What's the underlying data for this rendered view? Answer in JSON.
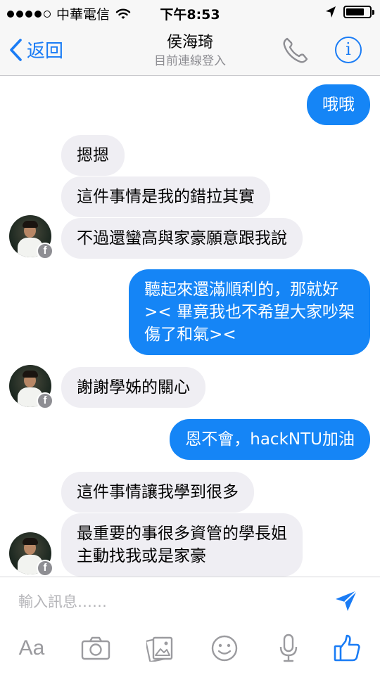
{
  "status_bar": {
    "carrier": "中華電信",
    "time": "下午8:53"
  },
  "nav": {
    "back_label": "返回",
    "contact_name": "侯海琦",
    "contact_status": "目前連線登入"
  },
  "messages": [
    {
      "side": "out",
      "text": "哦哦"
    },
    {
      "side": "in",
      "text": "摁摁"
    },
    {
      "side": "in",
      "text": "這件事情是我的錯拉其實"
    },
    {
      "side": "in",
      "text": "不過還蠻高與家豪願意跟我說"
    },
    {
      "side": "out",
      "text": "聽起來還滿順利的，那就好\n>< 畢竟我也不希望大家吵架\n傷了和氣><"
    },
    {
      "side": "in",
      "text": "謝謝學姊的關心"
    },
    {
      "side": "out",
      "text": "恩不會，hackNTU加油"
    },
    {
      "side": "in",
      "text": "這件事情讓我學到很多"
    },
    {
      "side": "in",
      "text": "最重要的事很多資管的學長姐\n主動找我或是家豪"
    }
  ],
  "avatar_badge": "f",
  "composer": {
    "placeholder": "輸入訊息……",
    "text_tool_label": "Aa"
  },
  "colors": {
    "accent": "#1a7cf5",
    "outgoing_bubble": "#1585f6",
    "incoming_bubble": "#efeef3",
    "icon_gray": "#9b9b9f"
  },
  "icons": [
    "signal-dots-icon",
    "wifi-icon",
    "location-arrow-icon",
    "battery-icon",
    "back-chevron-icon",
    "phone-icon",
    "info-icon",
    "send-icon",
    "text-format-icon",
    "camera-icon",
    "photo-icon",
    "emoji-icon",
    "microphone-icon",
    "like-icon"
  ]
}
